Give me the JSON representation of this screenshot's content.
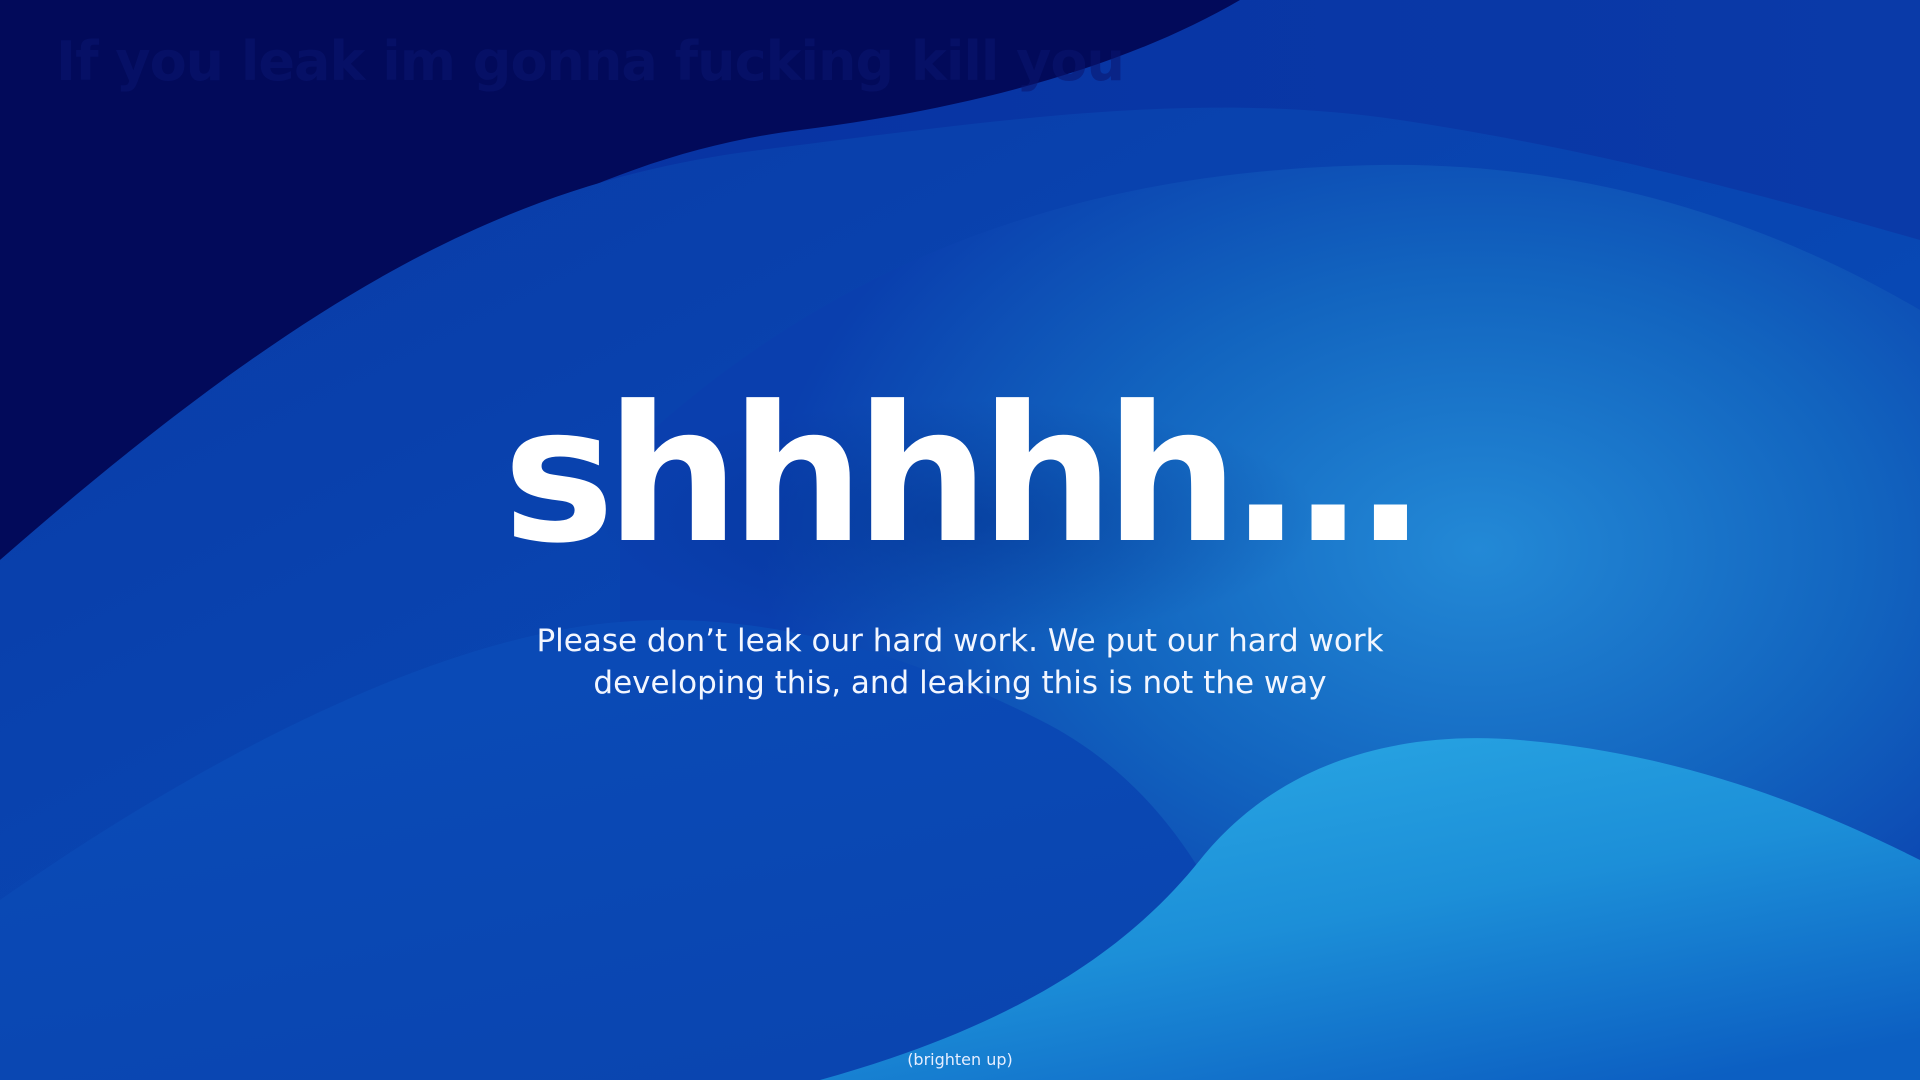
{
  "page": {
    "hidden_line": "If you leak im gonna fucking kill you",
    "headline": "shhhhh...",
    "subtext_line1": "Please don’t leak our hard work. We put our hard work",
    "subtext_line2": "developing this, and leaking this is not the way",
    "footer_note": "(brighten up)"
  },
  "colors": {
    "deep_navy": "#020a5a",
    "royal_blue": "#0a3fb0",
    "mid_blue": "#1f7fce",
    "light_blue": "#29a6e3",
    "text": "#ffffff"
  }
}
